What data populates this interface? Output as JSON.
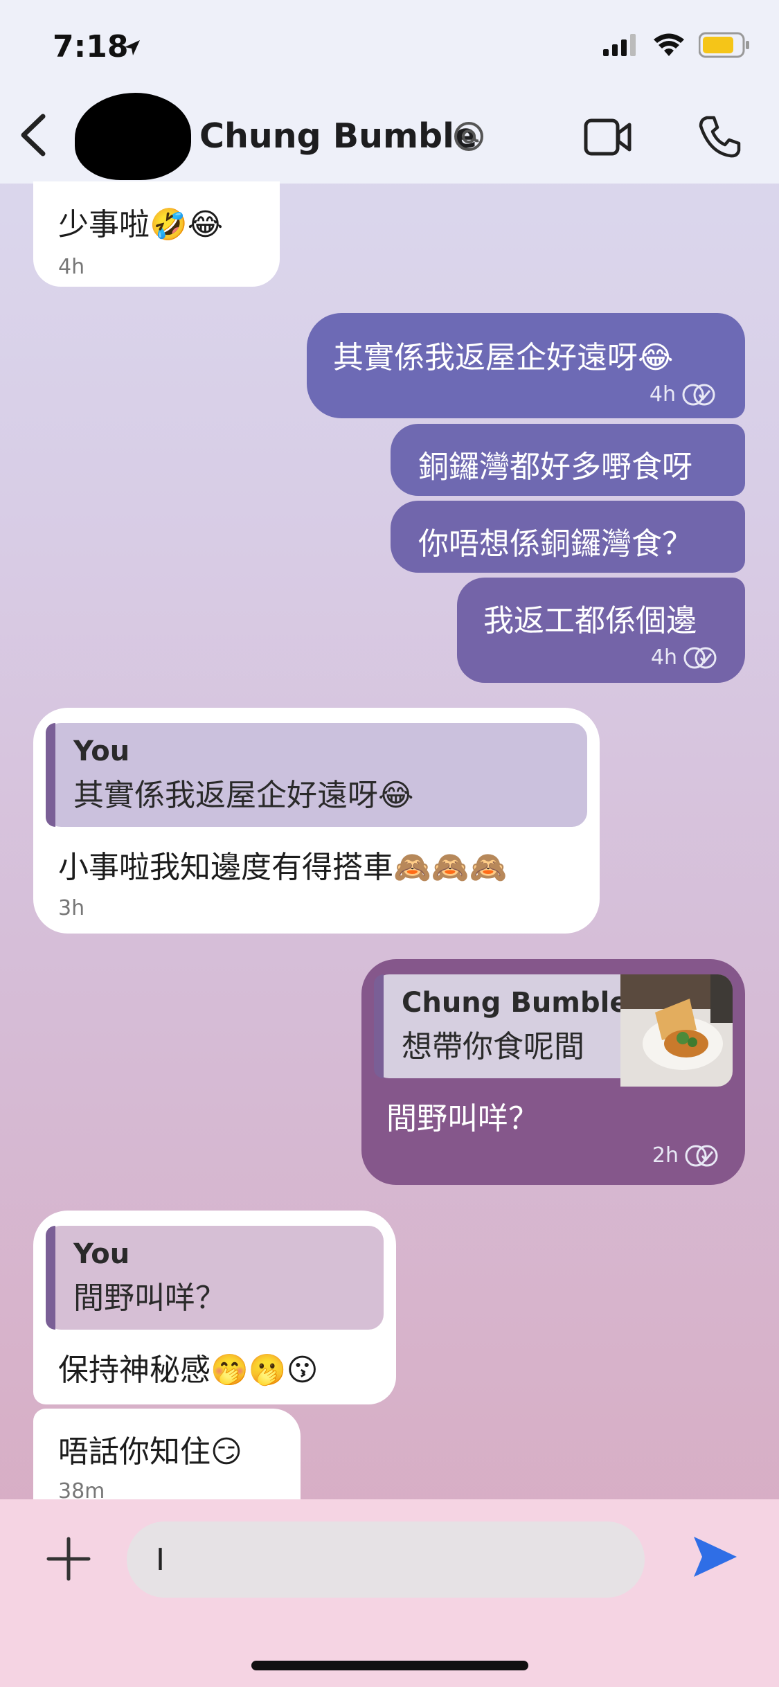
{
  "status": {
    "time": "7:18"
  },
  "header": {
    "contact_name": "Chung Bumble"
  },
  "messages": {
    "m1": {
      "text": "少事啦🤣😂",
      "time": "4h"
    },
    "m2": {
      "text": "其實係我返屋企好遠呀😂",
      "time": "4h"
    },
    "m3": {
      "text": "銅鑼灣都好多嘢食呀"
    },
    "m4": {
      "text": "你唔想係銅鑼灣食？"
    },
    "m5": {
      "text": "我返工都係個邊",
      "time": "4h"
    },
    "m6": {
      "quote_author": "You",
      "quote_text": "其實係我返屋企好遠呀😂",
      "text": "小事啦我知邊度有得搭車🙈🙈🙈",
      "time": "3h"
    },
    "m7": {
      "quote_author": "Chung Bumble",
      "quote_text": "想帶你食呢間",
      "text": "間野叫咩？",
      "time": "2h"
    },
    "m8": {
      "quote_author": "You",
      "quote_text": "間野叫咩？",
      "text": "保持神秘感🤭🫢😗"
    },
    "m9": {
      "text": "唔話你知住😏",
      "time": "38m"
    }
  },
  "composer": {
    "input_value": "I"
  },
  "colors": {
    "outgoing_top": "#6b6ab6",
    "outgoing_bottom": "#8a5a8a",
    "send_icon": "#2f6ee6"
  }
}
